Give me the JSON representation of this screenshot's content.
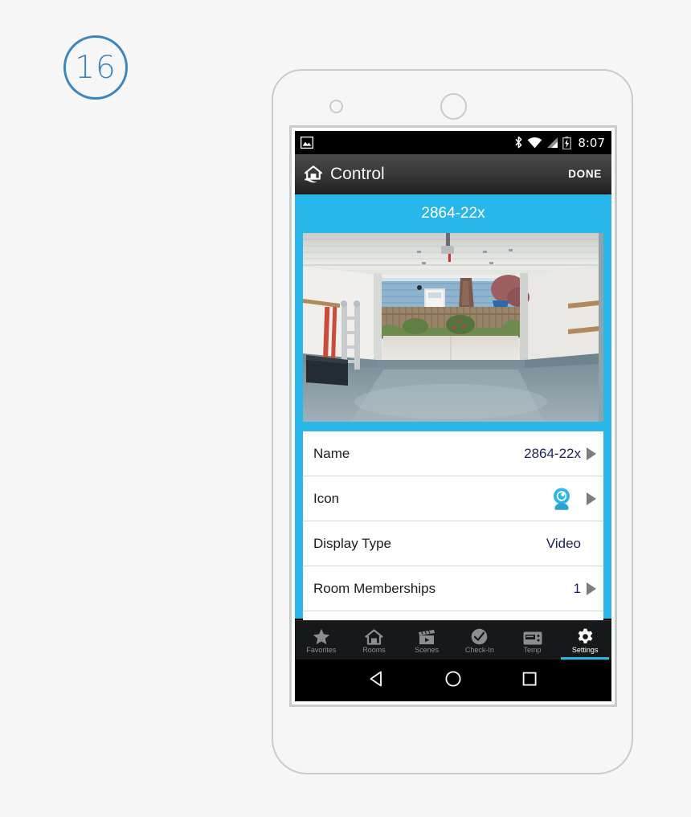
{
  "step_badge": {
    "number": "16"
  },
  "phone": {
    "sensor_icon": "proximity-sensor",
    "earpiece_icon": "front-camera"
  },
  "status_bar": {
    "left_icons": [
      "screenshot-image-icon"
    ],
    "right_icons": [
      "bluetooth-icon",
      "wifi-icon",
      "cellular-signal-icon",
      "battery-charging-icon"
    ],
    "clock": "8:07"
  },
  "app_bar": {
    "logo_icon": "home-hand-logo-icon",
    "title": "Control",
    "done_label": "DONE"
  },
  "device": {
    "name_header": "2864-22x",
    "photo_alt": "garage-interior-camera-snapshot"
  },
  "settings_rows": [
    {
      "label": "Name",
      "value": "2864-22x",
      "chevron": true,
      "icon": null
    },
    {
      "label": "Icon",
      "value": "",
      "chevron": true,
      "icon": "camera-icon"
    },
    {
      "label": "Display Type",
      "value": "Video",
      "chevron": false,
      "icon": null
    },
    {
      "label": "Room Memberships",
      "value": "1",
      "chevron": true,
      "icon": null
    }
  ],
  "tab_bar": {
    "tabs": [
      {
        "label": "Favorites",
        "icon": "star-icon",
        "active": false
      },
      {
        "label": "Rooms",
        "icon": "home-icon",
        "active": false
      },
      {
        "label": "Scenes",
        "icon": "clapperboard-icon",
        "active": false
      },
      {
        "label": "Check-In",
        "icon": "check-circle-icon",
        "active": false
      },
      {
        "label": "Temp",
        "icon": "thermostat-icon",
        "active": false
      },
      {
        "label": "Settings",
        "icon": "gear-icon",
        "active": true
      }
    ]
  },
  "nav_bar": {
    "buttons": [
      {
        "label": "Back",
        "icon": "back-triangle-icon"
      },
      {
        "label": "Home",
        "icon": "home-circle-icon"
      },
      {
        "label": "Recents",
        "icon": "recents-square-icon"
      }
    ]
  },
  "colors": {
    "accent_blue": "#29b6e8",
    "badge_blue": "#3c86bf",
    "value_navy": "#20235c",
    "tab_inactive": "#8b8d90"
  }
}
